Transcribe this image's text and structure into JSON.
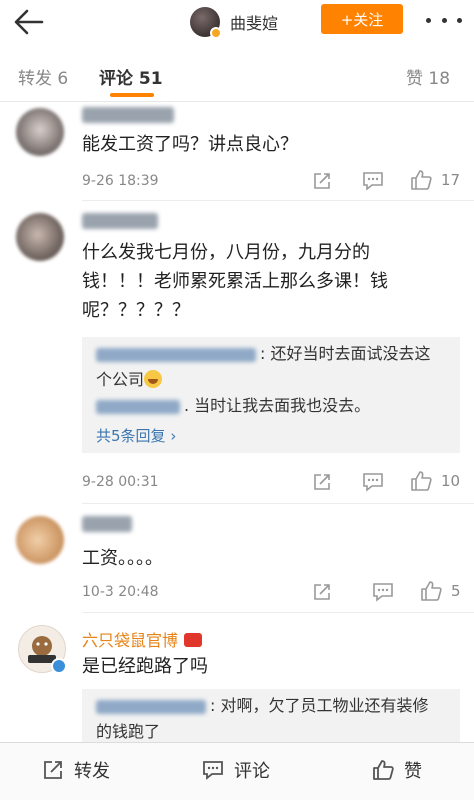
{
  "topbar": {
    "back_icon": "arrow-left-icon",
    "username": "曲斐媗",
    "follow_label": "+关注",
    "accent": "#ff8200"
  },
  "tabs": [
    {
      "label": "转发 6"
    },
    {
      "label": "评论 51"
    },
    {
      "label": "赞 18"
    }
  ],
  "comments": [
    {
      "text": "能发工资了吗？讲点良心？",
      "time": "9-26 18:39",
      "likes": "17"
    },
    {
      "text_lines": [
        "什么发我七月份，八月份，九月分的",
        "钱！！！老师累死累活上那么多课！钱",
        "呢？？？？？"
      ],
      "replies": [
        {
          "text": ": 还好当时去面试没去这",
          "cont": "个公司"
        },
        {
          "text": ". 当时让我去面我也没去。"
        }
      ],
      "more_replies": "共5条回复 ",
      "time": "9-28 00:31",
      "likes": "10"
    },
    {
      "text": "工资。。。。",
      "time": "10-3 20:48",
      "likes": "5"
    },
    {
      "name": "六只袋鼠官博",
      "text": "是已经跑路了吗",
      "replies": [
        {
          "text": ": 对啊，欠了员工物业还有装修",
          "cont": "的钱跑了"
        }
      ]
    }
  ],
  "bottombar": {
    "repost_label": "转发",
    "comment_label": "评论",
    "like_label": "赞"
  }
}
